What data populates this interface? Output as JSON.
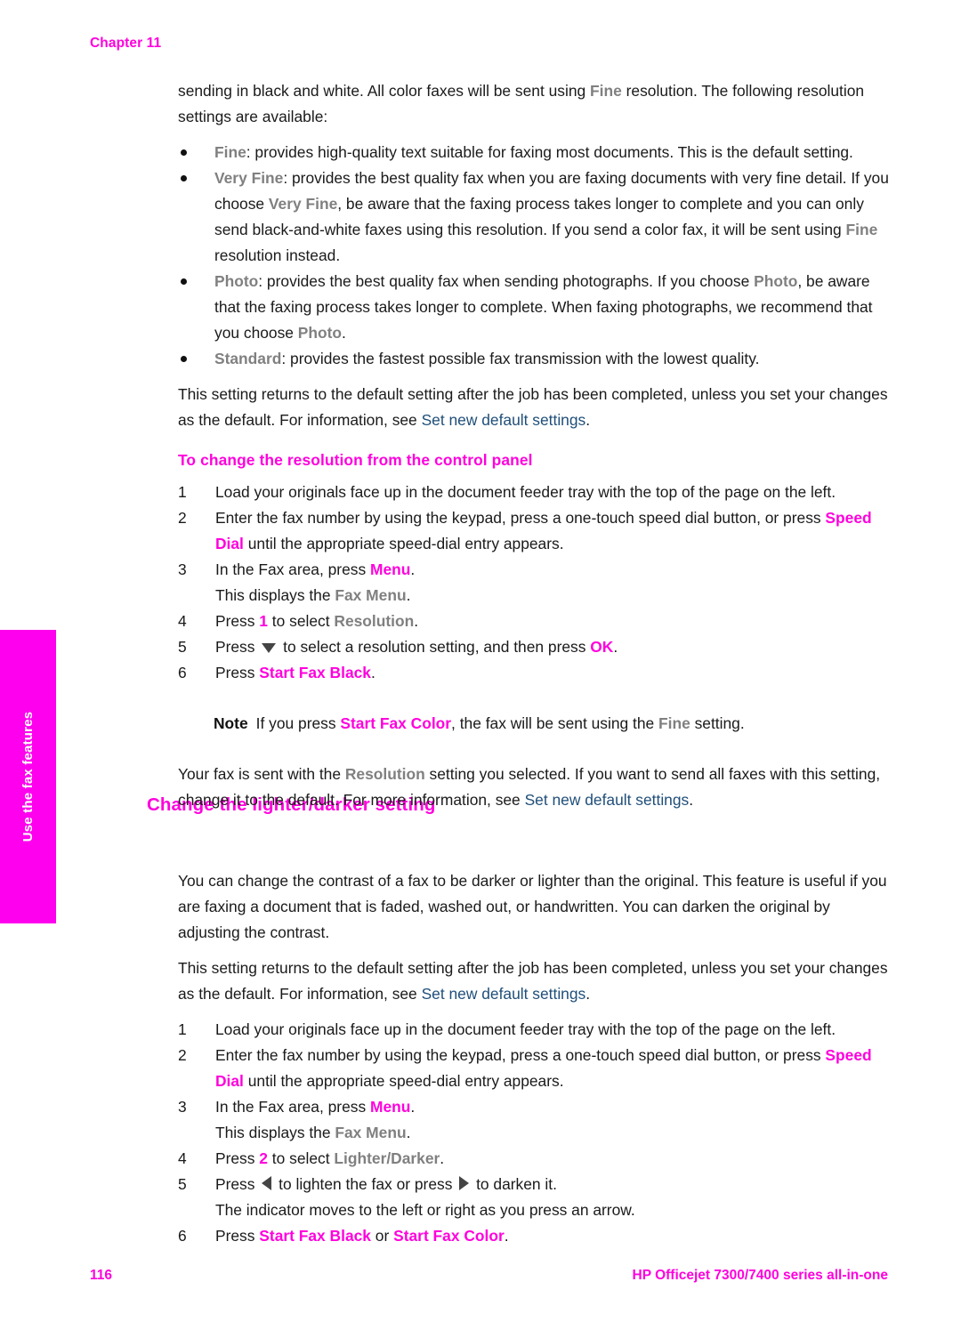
{
  "page": {
    "chapter_label": "Chapter 11",
    "footer_page_number": "116",
    "footer_product": "HP Officejet 7300/7400 series all-in-one",
    "side_tab_label": "Use the fax features",
    "colors": {
      "accent_magenta": "#ff00dd",
      "tab_magenta": "#ff00ee",
      "ui_term_gray": "#808080",
      "link_blue": "#1f4e79",
      "body_text": "#1a1a1a"
    }
  },
  "intro": {
    "line1_a": "sending in black and white. All color faxes will be sent using ",
    "line1_ui": "Fine",
    "line1_b": " resolution. The following resolution settings are available:"
  },
  "resolution_bullets": [
    {
      "term": "Fine",
      "text": ": provides high-quality text suitable for faxing most documents. This is the default setting."
    },
    {
      "term": "Very Fine",
      "text_a": ": provides the best quality fax when you are faxing documents with very fine detail. If you choose ",
      "inline_ui_1": "Very Fine",
      "text_b": ", be aware that the faxing process takes longer to complete and you can only send black-and-white faxes using this resolution. If you send a color fax, it will be sent using ",
      "inline_ui_2": "Fine",
      "text_c": " resolution instead."
    },
    {
      "term": "Photo",
      "text_a": ": provides the best quality fax when sending photographs. If you choose ",
      "inline_ui_1": "Photo",
      "text_b": ", be aware that the faxing process takes longer to complete. When faxing photographs, we recommend that you choose ",
      "inline_ui_2": "Photo",
      "text_c": "."
    },
    {
      "term": "Standard",
      "text": ": provides the fastest possible fax transmission with the lowest quality."
    }
  ],
  "default_note_para": {
    "text_a": "This setting returns to the default setting after the job has been completed, unless you set your changes as the default. For information, see ",
    "link": "Set new default settings",
    "text_b": "."
  },
  "procedure_resolution": {
    "heading": "To change the resolution from the control panel",
    "steps": [
      {
        "num": "1",
        "text": "Load your originals face up in the document feeder tray with the top of the page on the left."
      },
      {
        "num": "2",
        "text_a": "Enter the fax number by using the keypad, press a one-touch speed dial button, or press ",
        "btn": "Speed Dial",
        "text_b": " until the appropriate speed-dial entry appears."
      },
      {
        "num": "3",
        "text_a": "In the Fax area, press ",
        "btn": "Menu",
        "text_b": ".",
        "sub_a": "This displays the ",
        "sub_ui": "Fax Menu",
        "sub_b": "."
      },
      {
        "num": "4",
        "text_a": "Press ",
        "btn": "1",
        "text_b": " to select ",
        "ui": "Resolution",
        "text_c": "."
      },
      {
        "num": "5",
        "text_a": "Press ",
        "icon": "triangle-down-icon",
        "text_b": " to select a resolution setting, and then press ",
        "btn": "OK",
        "text_c": "."
      },
      {
        "num": "6",
        "text_a": "Press ",
        "btn": "Start Fax Black",
        "text_b": "."
      }
    ],
    "note": {
      "label": "Note",
      "text_a": "If you press ",
      "btn": "Start Fax Color",
      "text_b": ", the fax will be sent using the ",
      "ui": "Fine",
      "text_c": " setting."
    },
    "closing": {
      "text_a": "Your fax is sent with the ",
      "ui": "Resolution",
      "text_b": " setting you selected. If you want to send all faxes with this setting, change it to the default. For more information, see ",
      "link": "Set new default settings",
      "text_c": "."
    }
  },
  "section_lighter_darker": {
    "heading": "Change the lighter/darker setting",
    "para1": "You can change the contrast of a fax to be darker or lighter than the original. This feature is useful if you are faxing a document that is faded, washed out, or handwritten. You can darken the original by adjusting the contrast.",
    "para2": {
      "text_a": "This setting returns to the default setting after the job has been completed, unless you set your changes as the default. For information, see ",
      "link": "Set new default settings",
      "text_b": "."
    },
    "steps": [
      {
        "num": "1",
        "text": "Load your originals face up in the document feeder tray with the top of the page on the left."
      },
      {
        "num": "2",
        "text_a": "Enter the fax number by using the keypad, press a one-touch speed dial button, or press ",
        "btn": "Speed Dial",
        "text_b": " until the appropriate speed-dial entry appears."
      },
      {
        "num": "3",
        "text_a": "In the Fax area, press ",
        "btn": "Menu",
        "text_b": ".",
        "sub_a": "This displays the ",
        "sub_ui": "Fax Menu",
        "sub_b": "."
      },
      {
        "num": "4",
        "text_a": "Press ",
        "btn": "2",
        "text_b": " to select ",
        "ui": "Lighter/Darker",
        "text_c": "."
      },
      {
        "num": "5",
        "text_a": "Press ",
        "icon_left": "triangle-left-icon",
        "text_b": " to lighten the fax or press ",
        "icon_right": "triangle-right-icon",
        "text_c": " to darken it.",
        "sub": "The indicator moves to the left or right as you press an arrow."
      },
      {
        "num": "6",
        "text_a": "Press ",
        "btn_1": "Start Fax Black",
        "text_b": " or ",
        "btn_2": "Start Fax Color",
        "text_c": "."
      }
    ]
  }
}
